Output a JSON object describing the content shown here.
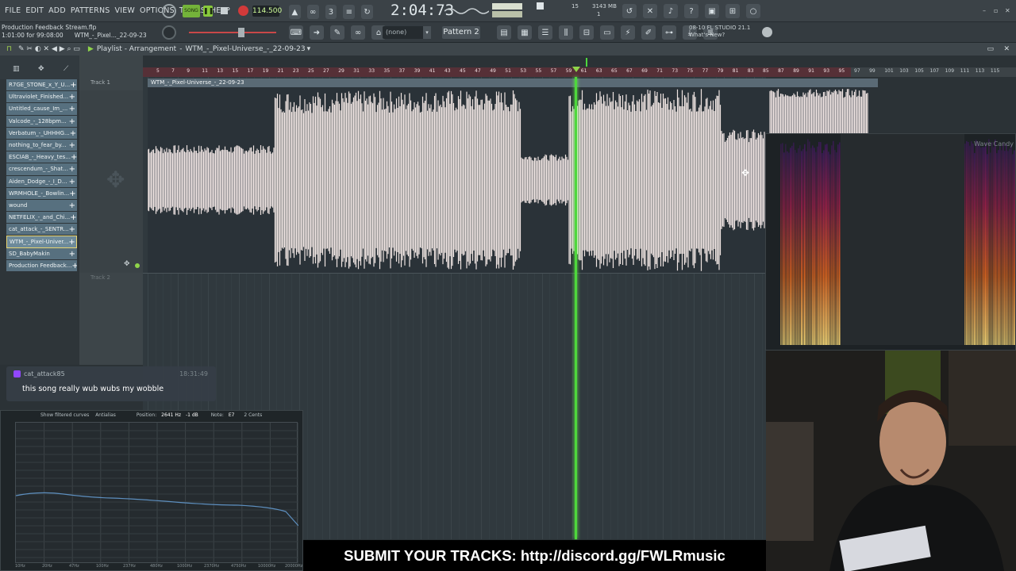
{
  "menu": [
    "FILE",
    "EDIT",
    "ADD",
    "PATTERNS",
    "VIEW",
    "OPTIONS",
    "TOOLS",
    "HELP"
  ],
  "transport": {
    "song_mode": "SONG",
    "tempo": "114.500",
    "time": "2:04:73",
    "memory": "3143 MB",
    "cpu": "15",
    "poly": "1"
  },
  "project": {
    "file": "Production Feedback Stream.flp",
    "info": "1:01:00 for 99:08:00",
    "clip_hint": "WTM_-_Pixel..._22-09-23"
  },
  "pattern_selector": {
    "none": "(none)",
    "pattern": "Pattern 2"
  },
  "fl_news": {
    "date": "08-10",
    "version": "FL STUDIO 21.1",
    "whats_new": "What's New?"
  },
  "playlist": {
    "title": "Playlist - Arrangement",
    "arrangement": "WTM_-_Pixel-Universe_-_22-09-23",
    "track1": "Track 1",
    "track2": "Track 2",
    "clip_name": "WTM_-_Pixel-Universe_-_22-09-23"
  },
  "clips": [
    "R7GE_STONE_x_Y_U...",
    "Ultraviolet_Finished...",
    "Untitled_cause_Im_...",
    "Valcode_-_128bpm...",
    "Verbatum_-_UHHHG...",
    "nothing_to_fear_by...",
    "ESCIAB_-_Heavy_tes...",
    "crescendum_-_Shat...",
    "Aiden_Dodge_-_I_D...",
    "WRMHOLE_-_Bowlin...",
    "wound",
    "NETFELIX_-_and_Chi...",
    "cat_attack_-_SENTR...",
    "WTM_-_Pixel-Univer...",
    "SD_BabyMakin",
    "Production Feedback..."
  ],
  "selected_clip_index": 13,
  "ruler_marks": [
    "5",
    "7",
    "9",
    "11",
    "13",
    "15",
    "17",
    "19",
    "21",
    "23",
    "25",
    "27",
    "29",
    "31",
    "33",
    "35",
    "37",
    "39",
    "41",
    "43",
    "45",
    "47",
    "49",
    "51",
    "53",
    "55",
    "57",
    "59",
    "61",
    "63",
    "65",
    "67",
    "69",
    "71",
    "73",
    "75",
    "77",
    "79",
    "81",
    "83",
    "85",
    "87",
    "89",
    "91",
    "93",
    "95"
  ],
  "ruler_marks_right": [
    "97",
    "99",
    "101",
    "103",
    "105",
    "107",
    "109",
    "111",
    "113",
    "115"
  ],
  "wave_candy": {
    "title": "Wave Candy"
  },
  "chat": {
    "user": "cat_attack85",
    "time": "18:31:49",
    "message": "this song really wub wubs my wobble"
  },
  "eq_panel": {
    "show_filtered": "Show filtered curves",
    "antialias": "Antialias",
    "position": "Position:",
    "position_value": "2641 Hz",
    "gain": "-1 dB",
    "note_label": "Note:",
    "note_value": "E7",
    "cents": "2 Cents",
    "x_labels": [
      "10Hz",
      "20Hz",
      "47Hz",
      "100Hz",
      "237Hz",
      "480Hz",
      "1000Hz",
      "2370Hz",
      "4750Hz",
      "10000Hz",
      "20000Hz"
    ]
  },
  "banner": "SUBMIT YOUR TRACKS: http://discord.gg/FWLRmusic",
  "colors": {
    "playhead": "#4ed83c",
    "waveform": "#efe4e2",
    "ruler": "#563037",
    "clip": "#57707f"
  }
}
